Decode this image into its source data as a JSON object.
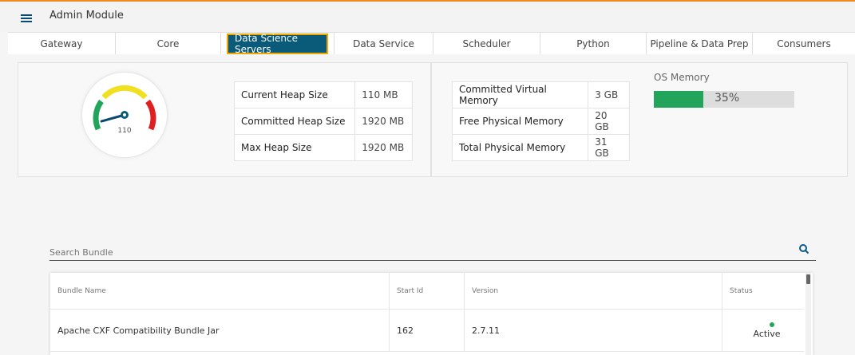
{
  "app": {
    "title": "Admin Module",
    "menu_icon": "hamburger-icon"
  },
  "tabs": [
    {
      "label": "Gateway"
    },
    {
      "label": "Core"
    },
    {
      "label": "Data Science Servers",
      "active": true
    },
    {
      "label": "Data Service"
    },
    {
      "label": "Scheduler"
    },
    {
      "label": "Python"
    },
    {
      "label": "Pipeline & Data Prep"
    },
    {
      "label": "Consumers"
    }
  ],
  "gauge": {
    "value": "110",
    "needle_fraction": 0.06
  },
  "heap": [
    {
      "label": "Current Heap Size",
      "value": "110 MB"
    },
    {
      "label": "Committed Heap Size",
      "value": "1920 MB"
    },
    {
      "label": "Max Heap Size",
      "value": "1920 MB"
    }
  ],
  "memory": [
    {
      "label": "Committed Virtual Memory",
      "value": "3 GB"
    },
    {
      "label": "Free Physical Memory",
      "value": "20 GB"
    },
    {
      "label": "Total Physical Memory",
      "value": "31 GB"
    }
  ],
  "os_memory": {
    "label": "OS Memory",
    "percent_text": "35%",
    "fraction": 0.35
  },
  "search": {
    "placeholder": "Search Bundle",
    "icon": "search-icon"
  },
  "table": {
    "headers": [
      "Bundle Name",
      "Start Id",
      "Version",
      "Status"
    ],
    "rows": [
      {
        "name": "Apache CXF Compatibility Bundle Jar",
        "start_id": "162",
        "version": "2.7.11",
        "status": "Active"
      }
    ]
  },
  "colors": {
    "accent": "#0a5a7a",
    "highlight_border": "#f0a500",
    "active_green": "#22a55a",
    "top_border": "#f08a24"
  }
}
